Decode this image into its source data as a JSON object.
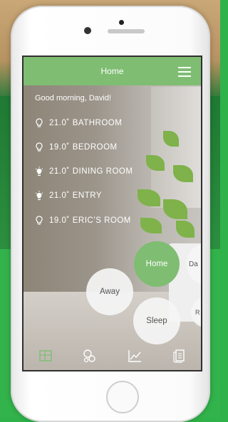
{
  "app": {
    "title": "Home",
    "greeting": "Good morning, David!"
  },
  "rooms": [
    {
      "temp": "21.0˚",
      "name": "BATHROOM",
      "icon": "bulb-off-icon"
    },
    {
      "temp": "19.0˚",
      "name": "BEDROOM",
      "icon": "bulb-off-icon"
    },
    {
      "temp": "21.0˚",
      "name": "DINING ROOM",
      "icon": "bulb-on-icon"
    },
    {
      "temp": "21.0˚",
      "name": "ENTRY",
      "icon": "bulb-on-icon"
    },
    {
      "temp": "19.0˚",
      "name": "ERIC’S ROOM",
      "icon": "bulb-off-icon"
    }
  ],
  "modes": {
    "home": "Home",
    "away": "Away",
    "sleep": "Sleep",
    "day_partial": "Da",
    "right_partial": "R"
  },
  "tabs": [
    {
      "name": "home-tab",
      "icon": "dashboard-icon"
    },
    {
      "name": "devices-tab",
      "icon": "devices-icon"
    },
    {
      "name": "stats-tab",
      "icon": "chart-icon"
    },
    {
      "name": "log-tab",
      "icon": "document-icon"
    }
  ],
  "colors": {
    "accent": "#7fbd72",
    "background": "#2fb24a"
  }
}
